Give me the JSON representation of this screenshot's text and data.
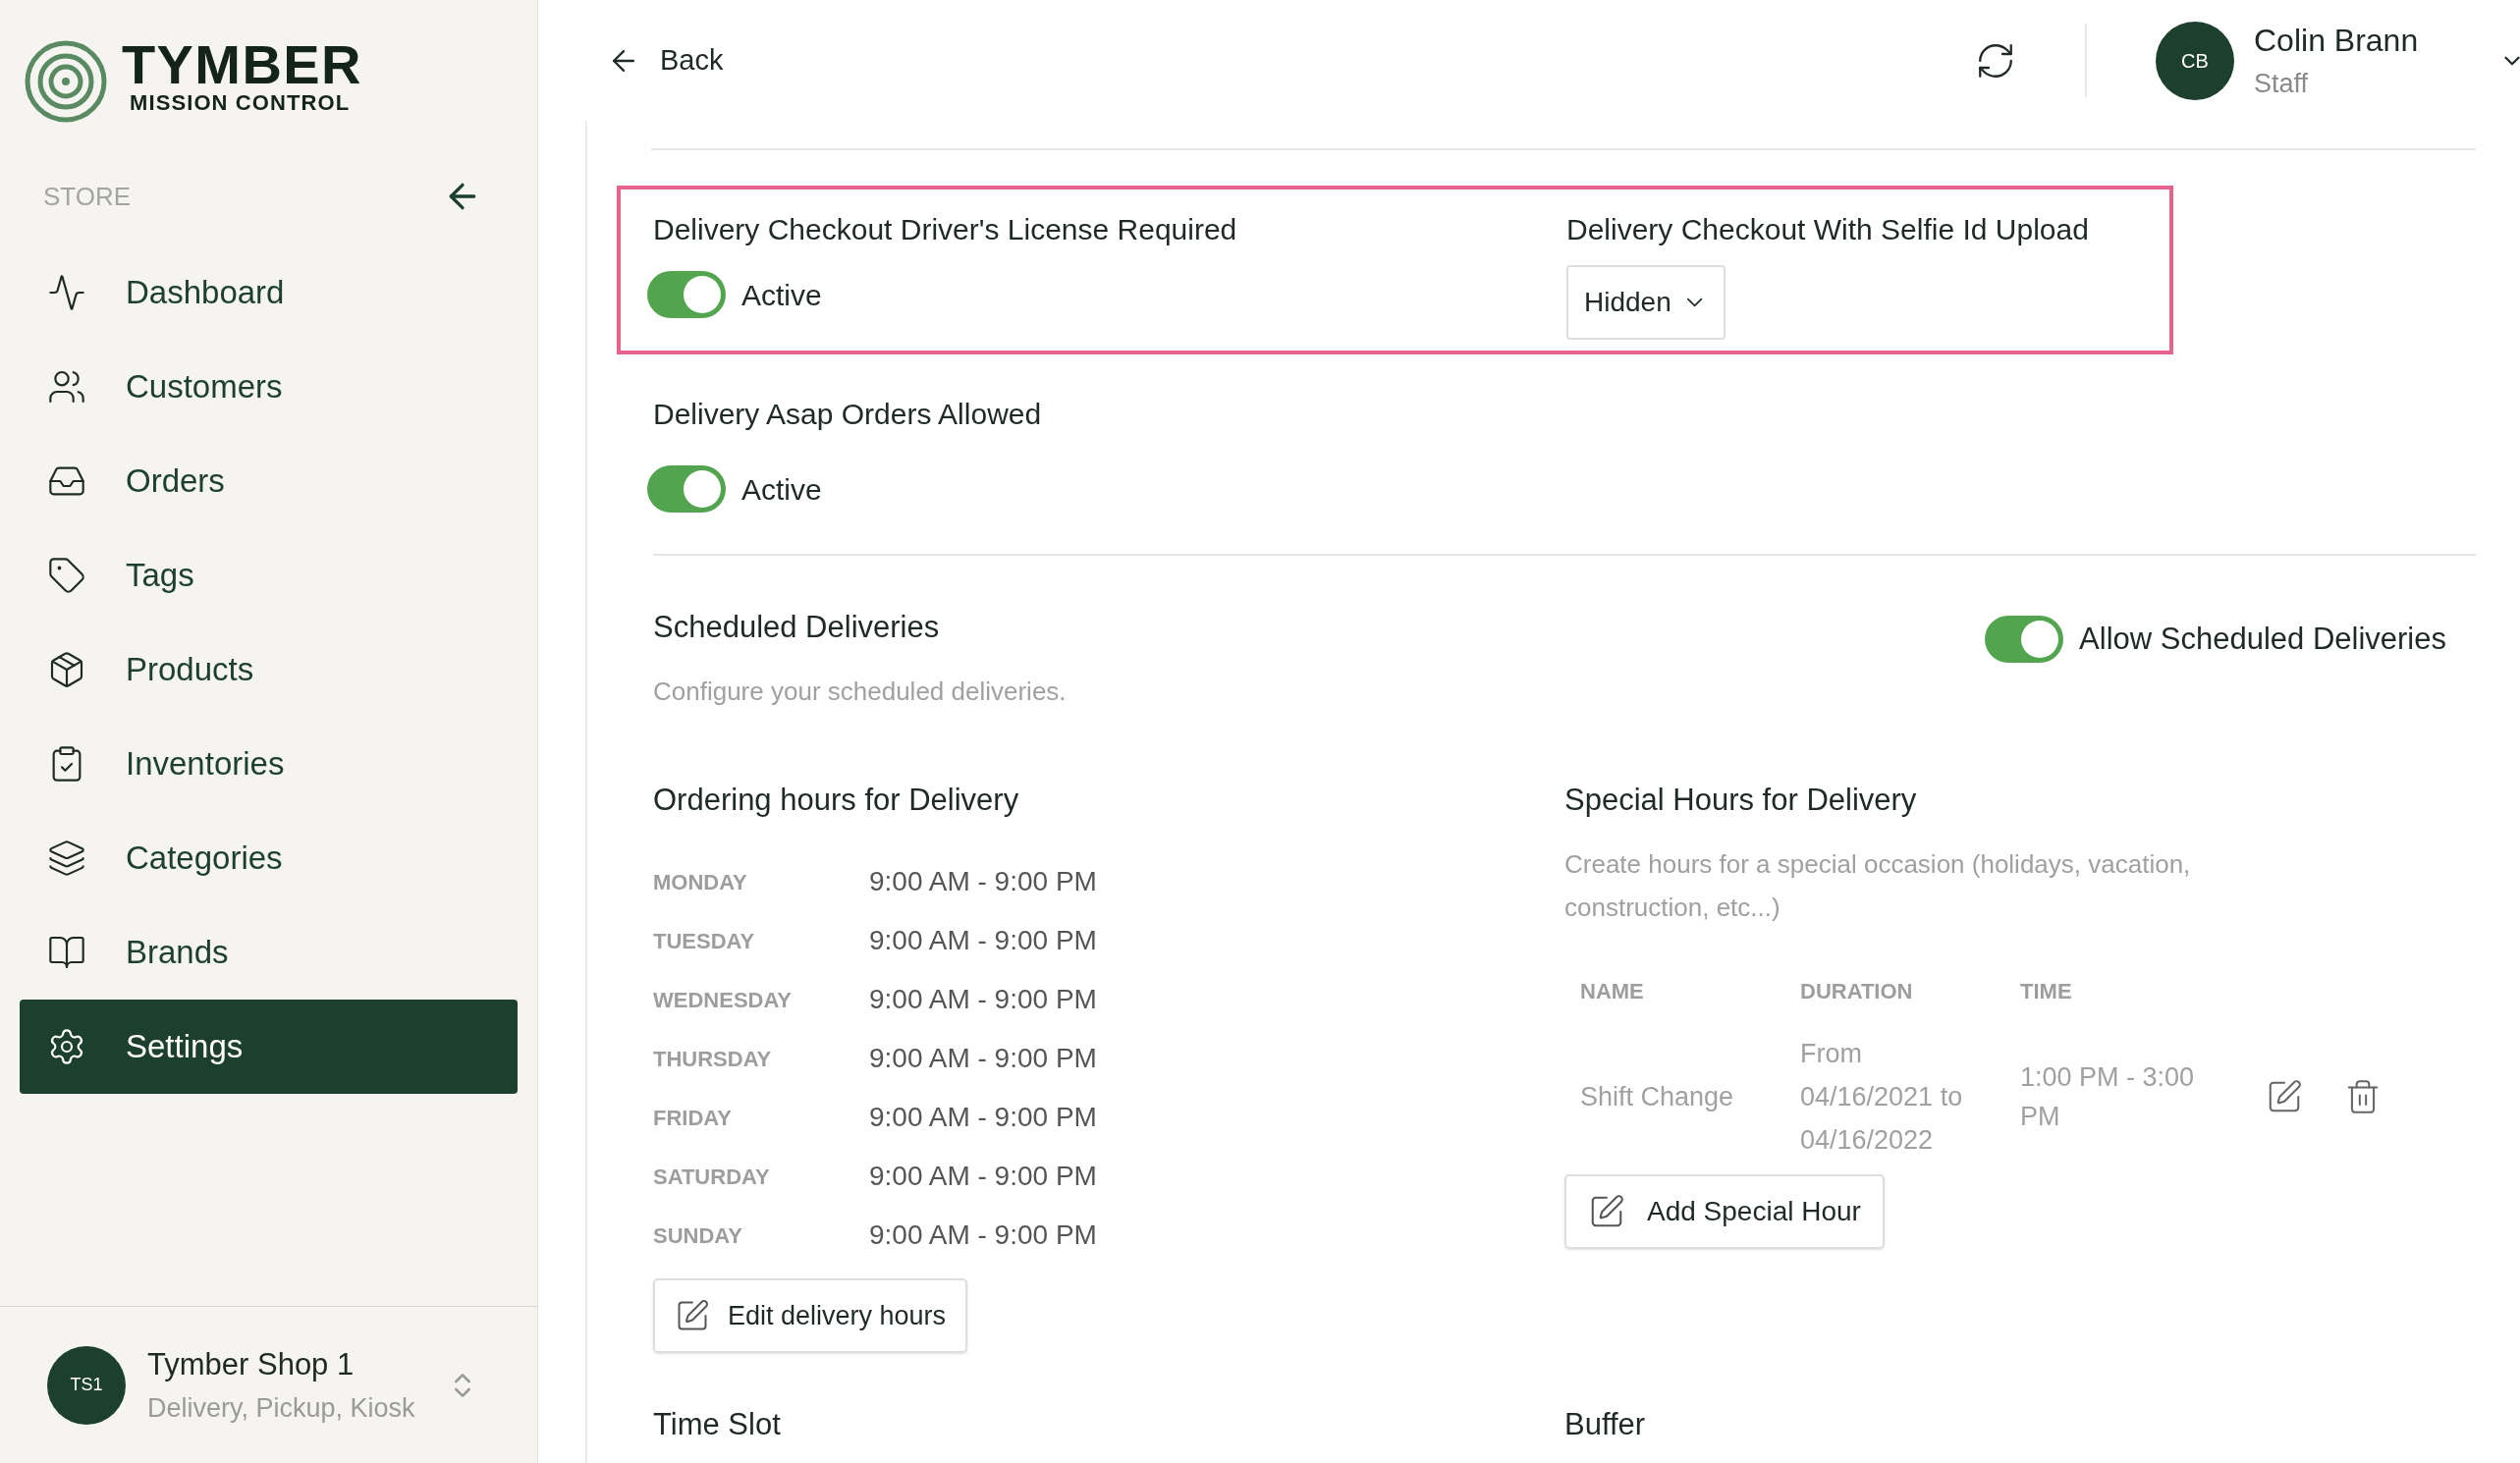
{
  "logo": {
    "title": "TYMBER",
    "subtitle": "MISSION CONTROL"
  },
  "sidebar": {
    "section": "STORE",
    "items": [
      {
        "label": "Dashboard",
        "selected": false
      },
      {
        "label": "Customers",
        "selected": false
      },
      {
        "label": "Orders",
        "selected": false
      },
      {
        "label": "Tags",
        "selected": false
      },
      {
        "label": "Products",
        "selected": false
      },
      {
        "label": "Inventories",
        "selected": false
      },
      {
        "label": "Categories",
        "selected": false
      },
      {
        "label": "Brands",
        "selected": false
      },
      {
        "label": "Settings",
        "selected": true
      }
    ]
  },
  "store_switcher": {
    "initials": "TS1",
    "name": "Tymber Shop 1",
    "subtitle": "Delivery, Pickup, Kiosk"
  },
  "header": {
    "back": "Back",
    "user": {
      "initials": "CB",
      "name": "Colin Brann",
      "role": "Staff"
    }
  },
  "highlight_box": {
    "highlighted": true,
    "license": {
      "label": "Delivery Checkout Driver's License Required",
      "on": true,
      "status": "Active"
    },
    "selfie": {
      "label": "Delivery Checkout With Selfie Id Upload",
      "value": "Hidden"
    }
  },
  "asap": {
    "label": "Delivery Asap Orders Allowed",
    "on": true,
    "status": "Active"
  },
  "scheduled": {
    "title": "Scheduled Deliveries",
    "description": "Configure your scheduled deliveries.",
    "toggle": {
      "label": "Allow Scheduled Deliveries",
      "on": true
    }
  },
  "ordering_hours": {
    "title": "Ordering hours for Delivery",
    "days": [
      {
        "day": "MONDAY",
        "hours": "9:00 AM - 9:00 PM"
      },
      {
        "day": "TUESDAY",
        "hours": "9:00 AM - 9:00 PM"
      },
      {
        "day": "WEDNESDAY",
        "hours": "9:00 AM - 9:00 PM"
      },
      {
        "day": "THURSDAY",
        "hours": "9:00 AM - 9:00 PM"
      },
      {
        "day": "FRIDAY",
        "hours": "9:00 AM - 9:00 PM"
      },
      {
        "day": "SATURDAY",
        "hours": "9:00 AM - 9:00 PM"
      },
      {
        "day": "SUNDAY",
        "hours": "9:00 AM - 9:00 PM"
      }
    ],
    "button": "Edit delivery hours"
  },
  "special_hours": {
    "title": "Special Hours for Delivery",
    "description": "Create hours for a special occasion (holidays, vacation, construction, etc...)",
    "columns": [
      "NAME",
      "DURATION",
      "TIME"
    ],
    "rows": [
      {
        "name": "Shift Change",
        "duration": "From 04/16/2021 to 04/16/2022",
        "time": "1:00 PM - 3:00 PM"
      }
    ],
    "button": "Add Special Hour"
  },
  "bottom_sections": [
    "Time Slot",
    "Buffer"
  ]
}
